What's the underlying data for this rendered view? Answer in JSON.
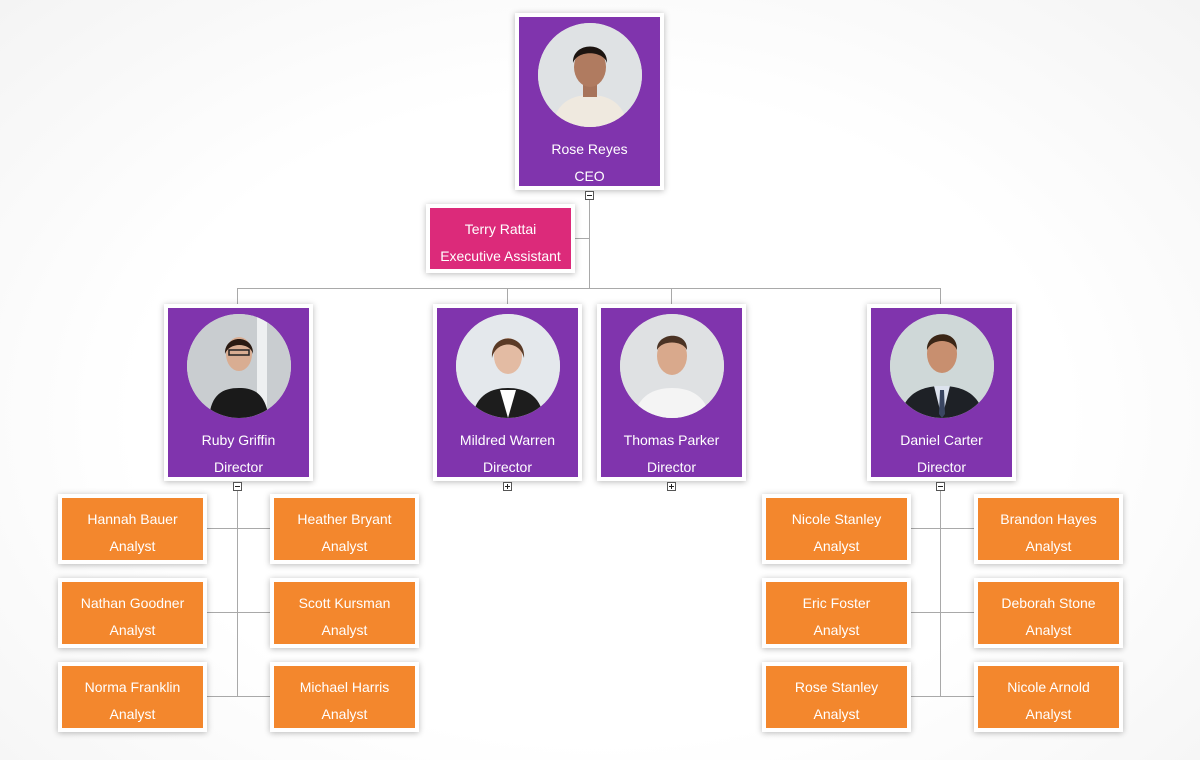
{
  "colors": {
    "director": "#8034ad",
    "assistant": "#dc2a7a",
    "analyst": "#f3872d",
    "connector": "#a9a9a9"
  },
  "ceo": {
    "name": "Rose Reyes",
    "title": "CEO",
    "photo": "woman-portrait",
    "toggle": "collapse"
  },
  "assistant": {
    "name": "Terry Rattai",
    "title": "Executive Assistant"
  },
  "directors": [
    {
      "name": "Ruby Griffin",
      "title": "Director",
      "photo": "woman-glasses-portrait",
      "toggle": "collapse"
    },
    {
      "name": "Mildred Warren",
      "title": "Director",
      "photo": "woman-portrait",
      "toggle": "expand"
    },
    {
      "name": "Thomas Parker",
      "title": "Director",
      "photo": "man-portrait",
      "toggle": "expand"
    },
    {
      "name": "Daniel Carter",
      "title": "Director",
      "photo": "man-suit-portrait",
      "toggle": "collapse"
    }
  ],
  "analysts_ruby": [
    {
      "name": "Hannah Bauer",
      "title": "Analyst"
    },
    {
      "name": "Heather Bryant",
      "title": "Analyst"
    },
    {
      "name": "Nathan Goodner",
      "title": "Analyst"
    },
    {
      "name": "Scott Kursman",
      "title": "Analyst"
    },
    {
      "name": "Norma Franklin",
      "title": "Analyst"
    },
    {
      "name": "Michael Harris",
      "title": "Analyst"
    }
  ],
  "analysts_daniel": [
    {
      "name": "Nicole Stanley",
      "title": "Analyst"
    },
    {
      "name": "Brandon Hayes",
      "title": "Analyst"
    },
    {
      "name": "Eric Foster",
      "title": "Analyst"
    },
    {
      "name": "Deborah Stone",
      "title": "Analyst"
    },
    {
      "name": "Rose Stanley",
      "title": "Analyst"
    },
    {
      "name": "Nicole Arnold",
      "title": "Analyst"
    }
  ]
}
